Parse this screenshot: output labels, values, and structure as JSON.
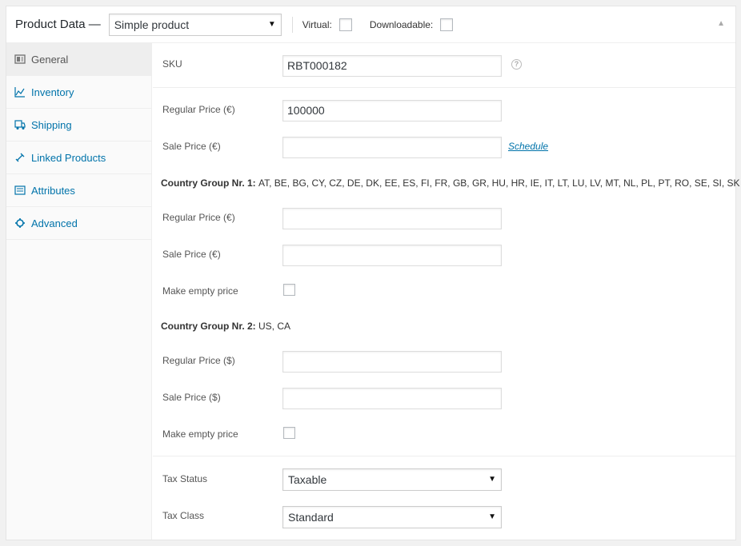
{
  "header": {
    "title": "Product Data —",
    "product_type": "Simple product",
    "virtual_label": "Virtual:",
    "downloadable_label": "Downloadable:"
  },
  "tabs": [
    {
      "label": "General",
      "icon": "general-icon",
      "active": true
    },
    {
      "label": "Inventory",
      "icon": "inventory-icon"
    },
    {
      "label": "Shipping",
      "icon": "shipping-icon"
    },
    {
      "label": "Linked Products",
      "icon": "link-icon"
    },
    {
      "label": "Attributes",
      "icon": "attributes-icon"
    },
    {
      "label": "Advanced",
      "icon": "gear-icon"
    }
  ],
  "sku": {
    "label": "SKU",
    "value": "RBT000182",
    "help": "?"
  },
  "pricing": {
    "regular_label": "Regular Price (€)",
    "regular_value": "100000",
    "sale_label": "Sale Price (€)",
    "sale_value": "",
    "schedule_label": "Schedule"
  },
  "group1": {
    "heading": "Country Group Nr. 1:",
    "countries": "AT, BE, BG, CY, CZ, DE, DK, EE, ES, FI, FR, GB, GR, HU, HR, IE, IT, LT, LU, LV, MT, NL, PL, PT, RO, SE, SI, SK",
    "regular_label": "Regular Price (€)",
    "sale_label": "Sale Price (€)",
    "empty_label": "Make empty price"
  },
  "group2": {
    "heading": "Country Group Nr. 2:",
    "countries": "US, CA",
    "regular_label": "Regular Price ($)",
    "sale_label": "Sale Price ($)",
    "empty_label": "Make empty price"
  },
  "tax": {
    "status_label": "Tax Status",
    "status_value": "Taxable",
    "class_label": "Tax Class",
    "class_value": "Standard"
  },
  "colors": {
    "link": "#0073aa",
    "border": "#dddddd"
  }
}
